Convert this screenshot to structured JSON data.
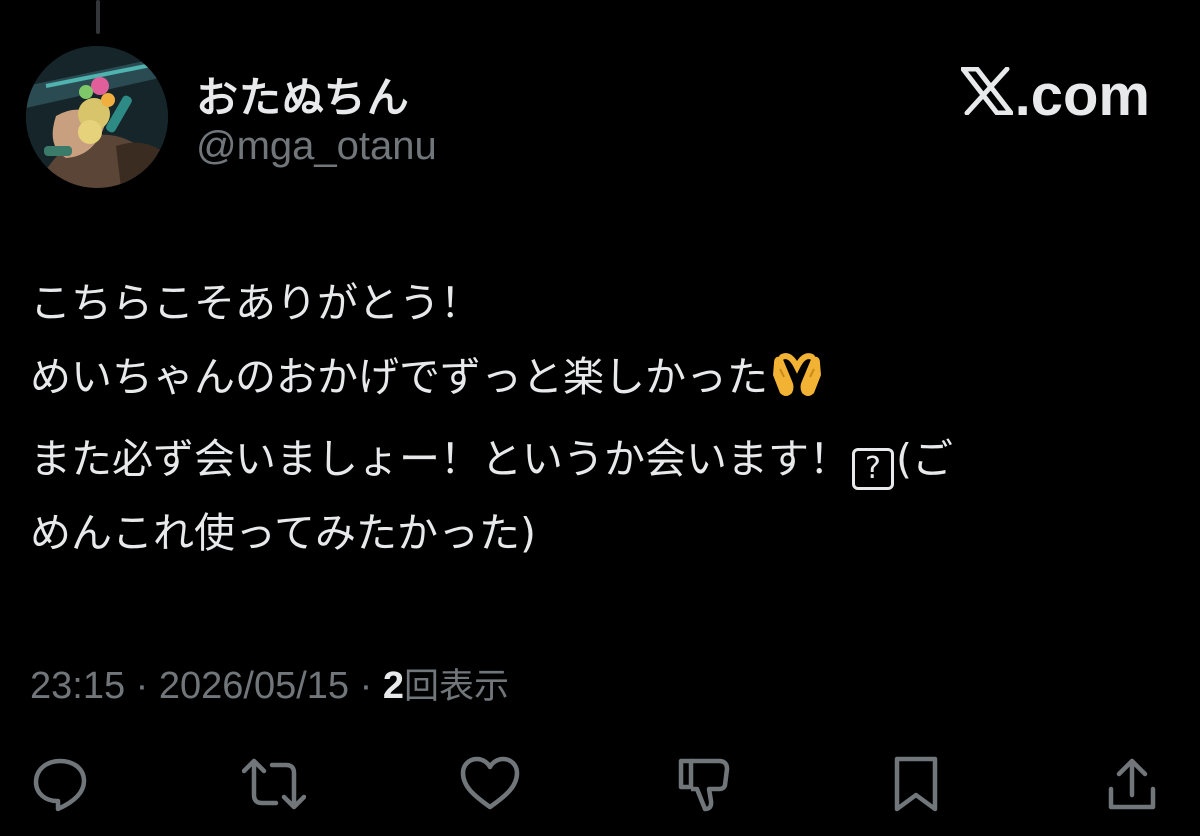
{
  "author": {
    "display_name": "おたぬちん",
    "handle": "@mga_otanu",
    "avatar_icon": "profile-photo-icon"
  },
  "watermark": {
    "text": ".com",
    "logo_icon": "x-logo-icon"
  },
  "tweet": {
    "lines": [
      "こちらこそありがとう！",
      "めいちゃんのおかげでずっと楽しかった",
      "また必ず会いましょー！というか会います！",
      "めんこれ使ってみたかった)"
    ],
    "line3_box_glyph": "?",
    "line3_tail": "(ご",
    "line2_emoji": "heart-hands-emoji"
  },
  "meta": {
    "time": "23:15",
    "separator": "·",
    "date": "2026/05/15",
    "views_count": "2",
    "views_label": "回表示"
  },
  "actions": {
    "reply_icon": "reply-icon",
    "repost_icon": "repost-icon",
    "like_icon": "heart-icon",
    "downvote_icon": "thumbs-down-icon",
    "bookmark_icon": "bookmark-icon",
    "share_icon": "share-icon"
  },
  "colors": {
    "background": "#000000",
    "primary_text": "#e7e9ea",
    "secondary_text": "#71767b"
  }
}
